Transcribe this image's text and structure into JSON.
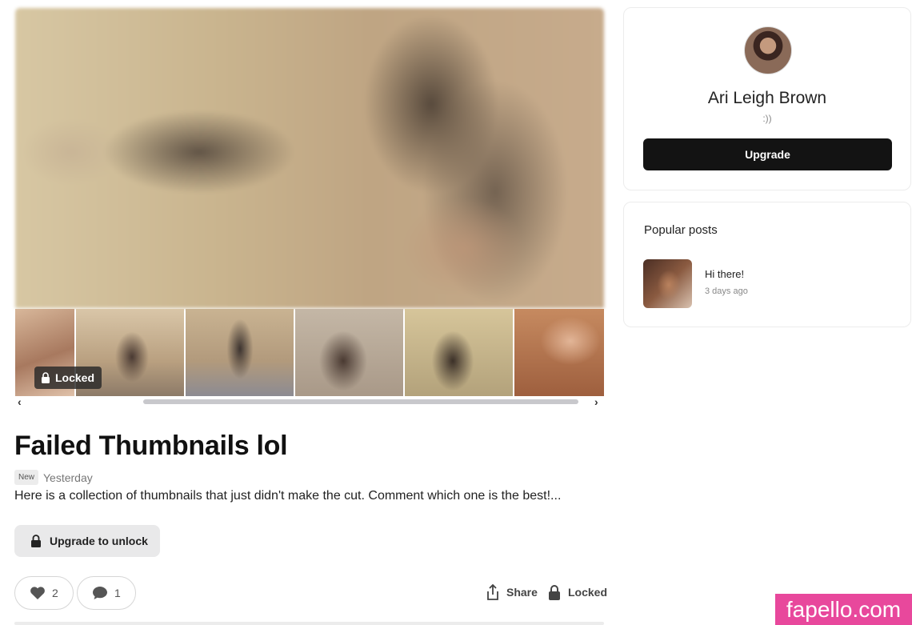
{
  "post": {
    "locked_badge": "Locked",
    "title": "Failed Thumbnails lol",
    "new_badge": "New",
    "date": "Yesterday",
    "description": "Here is a collection of thumbnails that just didn't make the cut. Comment which one is the best!...",
    "unlock_button": "Upgrade to unlock",
    "likes": "2",
    "comments": "1",
    "share_label": "Share",
    "locked_label": "Locked"
  },
  "scroller": {
    "left_arrow": "‹",
    "right_arrow": "›"
  },
  "profile": {
    "name": "Ari Leigh Brown",
    "bio": ":))",
    "upgrade_button": "Upgrade"
  },
  "popular": {
    "heading": "Popular posts",
    "items": [
      {
        "title": "Hi there!",
        "date": "3 days ago"
      }
    ]
  },
  "watermark": "fapello.com",
  "colors": {
    "primary_button": "#131313",
    "watermark": "#e8489c"
  }
}
